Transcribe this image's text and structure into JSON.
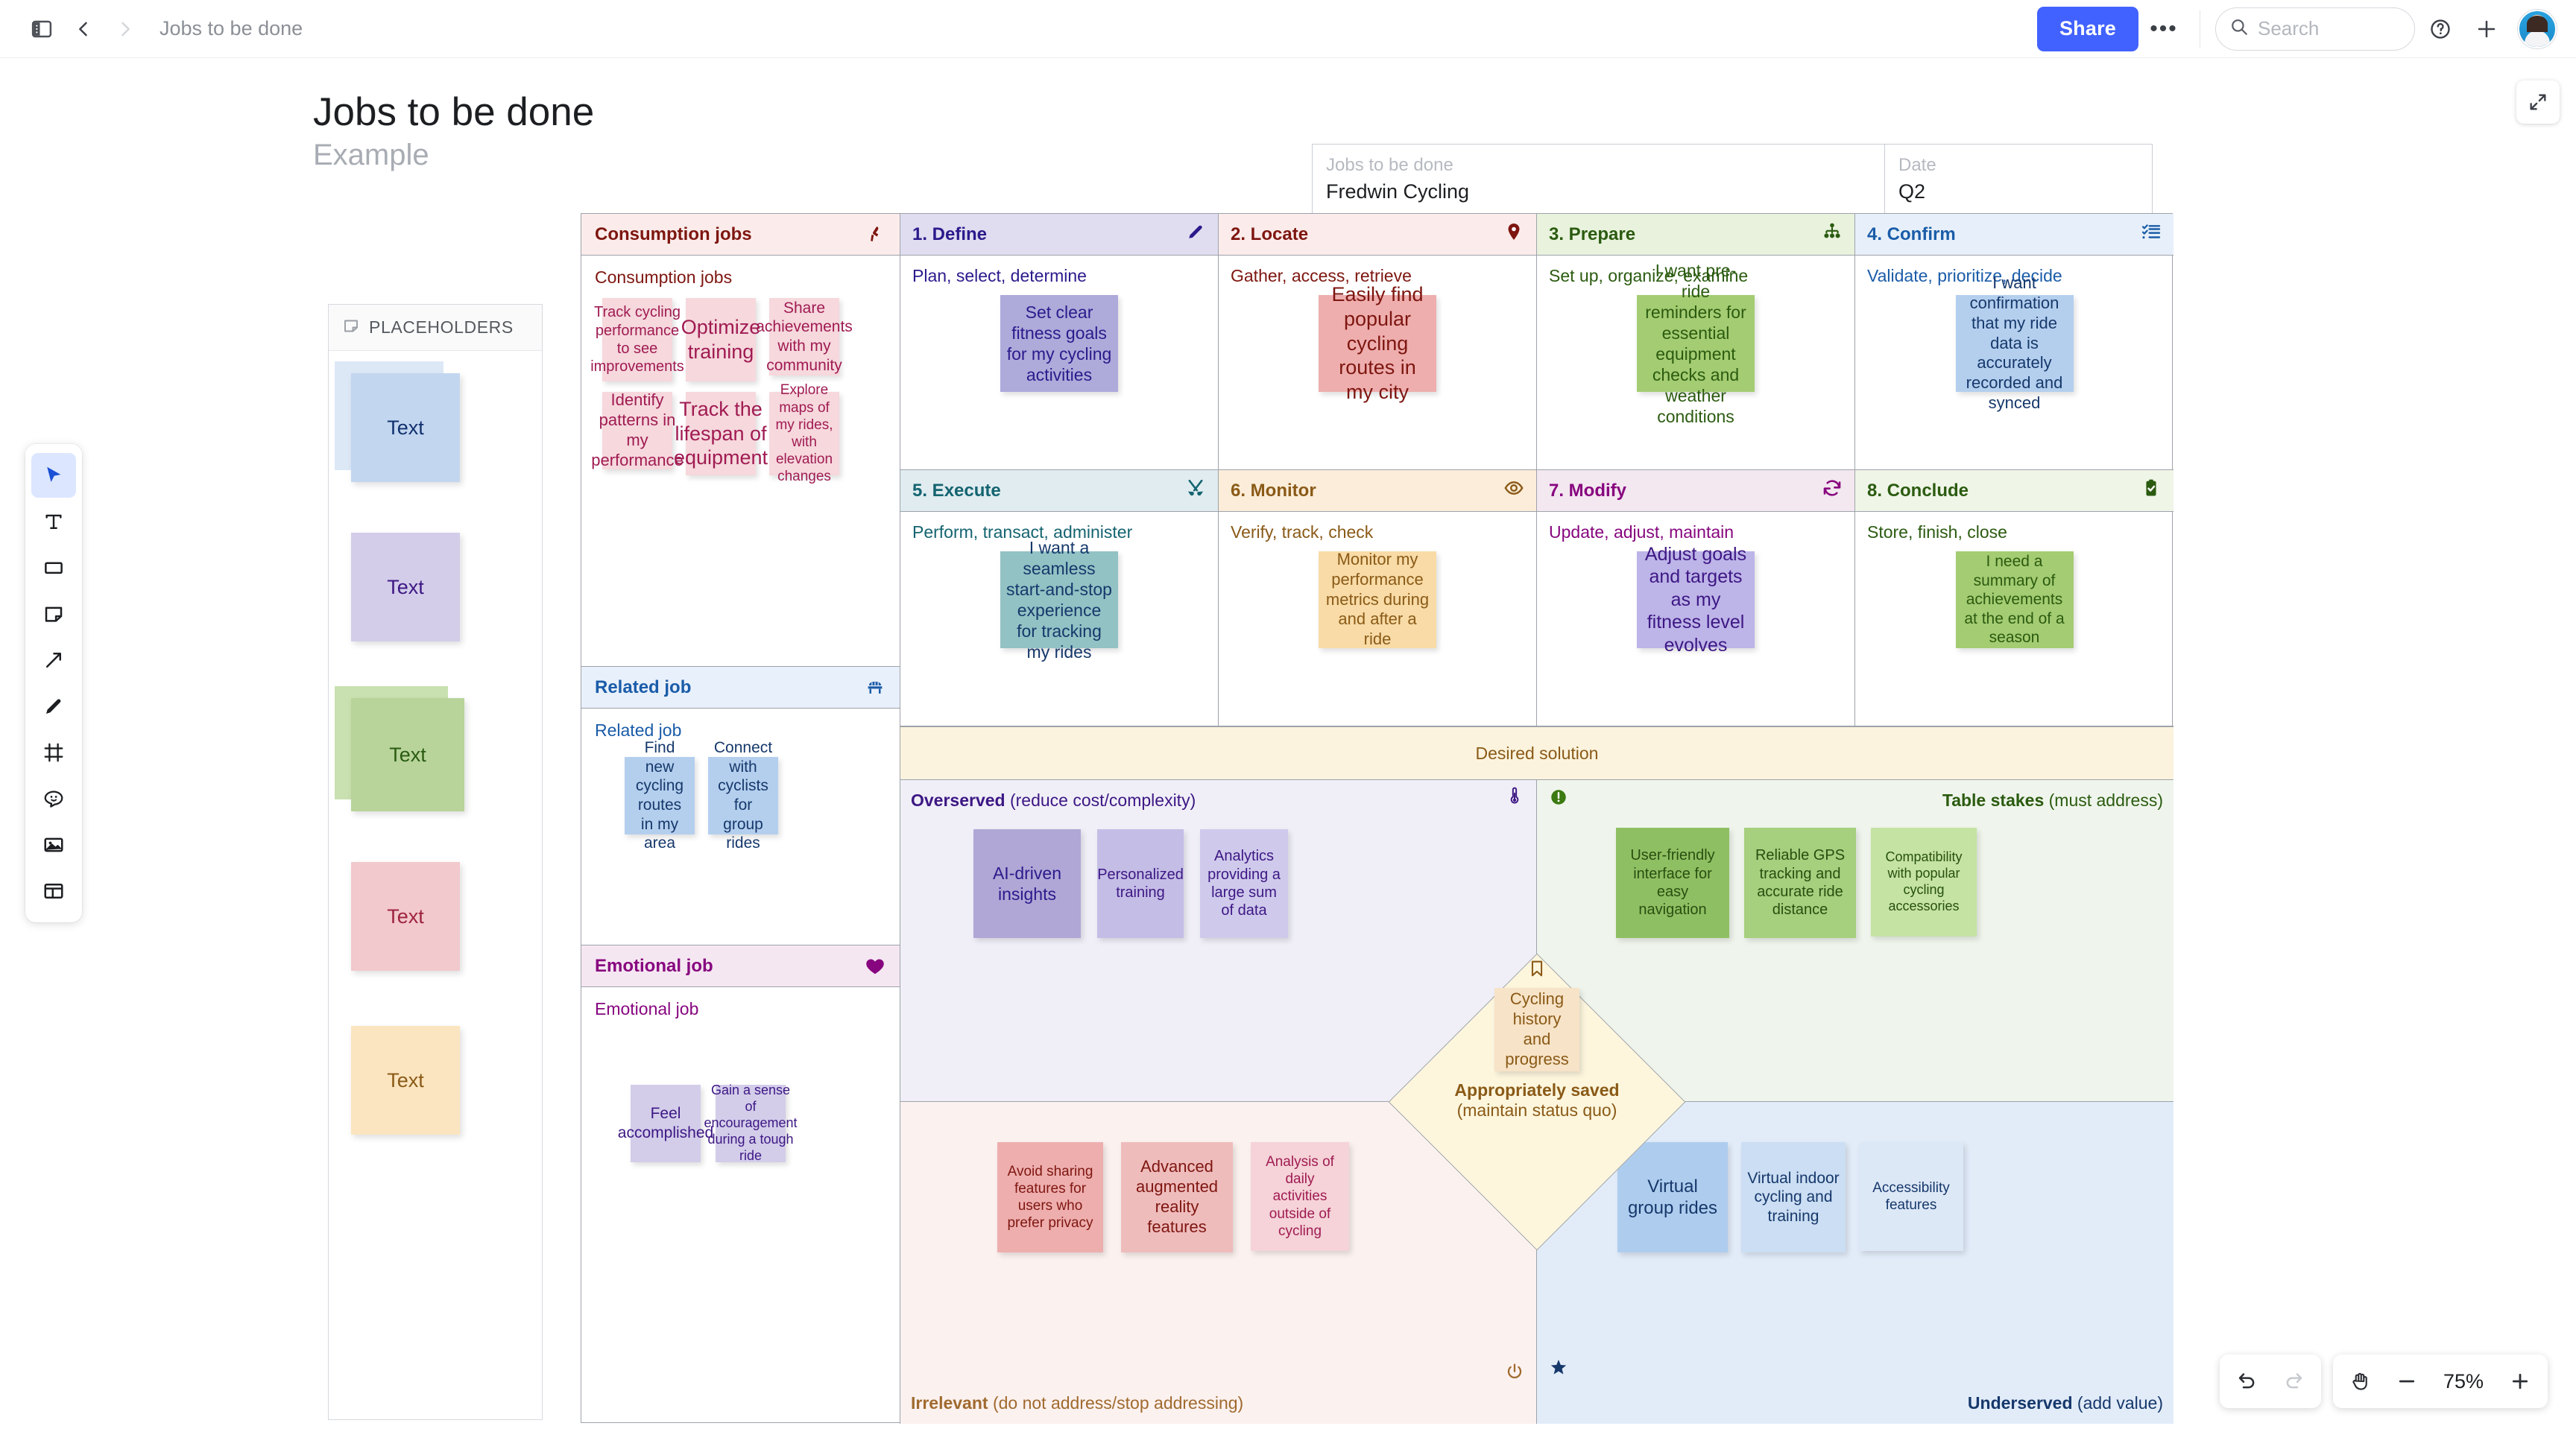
{
  "topbar": {
    "breadcrumb_title": "Jobs to be done",
    "share_label": "Share",
    "more_label": "•••",
    "search_placeholder": "Search",
    "icons": {
      "panel": "sidebar-panel-icon",
      "back": "chevron-left-icon",
      "forward": "chevron-right-icon",
      "search": "search-icon",
      "help": "help-circle-icon",
      "plus": "plus-icon",
      "avatar": "user-avatar"
    }
  },
  "toolbar": {
    "tools": [
      {
        "name": "select-tool",
        "icon": "cursor-arrow-icon",
        "active": true
      },
      {
        "name": "text-tool",
        "icon": "text-icon",
        "active": false
      },
      {
        "name": "shape-tool",
        "icon": "rectangle-icon",
        "active": false
      },
      {
        "name": "sticky-note-tool",
        "icon": "sticky-note-icon",
        "active": false
      },
      {
        "name": "connector-tool",
        "icon": "arrow-diagonal-icon",
        "active": false
      },
      {
        "name": "pen-tool",
        "icon": "pencil-icon",
        "active": false
      },
      {
        "name": "frame-tool",
        "icon": "frame-icon",
        "active": false
      },
      {
        "name": "emoji-tool",
        "icon": "smiley-icon",
        "active": false
      },
      {
        "name": "image-tool",
        "icon": "image-icon",
        "active": false
      },
      {
        "name": "template-tool",
        "icon": "layout-template-icon",
        "active": false
      }
    ]
  },
  "page": {
    "title": "Jobs to be done",
    "subtitle": "Example",
    "expand_icon": "expand-arrows-icon"
  },
  "meta": {
    "field1_label": "Jobs to be done",
    "field1_value": "Fredwin Cycling",
    "field2_label": "Date",
    "field2_value": "Q2"
  },
  "placeholders": {
    "header": "PLACEHOLDERS",
    "header_icon": "sticky-note-icon",
    "notes": [
      {
        "text": "Text",
        "color": "#c3d6f0",
        "back": "#dde8f7",
        "fg": "#11316e",
        "stacked": true
      },
      {
        "text": "Text",
        "color": "#d3cdea",
        "back": "",
        "fg": "#3d1784",
        "stacked": false
      },
      {
        "text": "Text",
        "color": "#b8d49a",
        "back": "#c9e0b0",
        "fg": "#2a5b12",
        "stacked": true
      },
      {
        "text": "Text",
        "color": "#f2c9cd",
        "back": "",
        "fg": "#9e2340",
        "stacked": false
      },
      {
        "text": "Text",
        "color": "#fbe5c0",
        "back": "",
        "fg": "#8a5a17",
        "stacked": false
      }
    ]
  },
  "board": {
    "consumption": {
      "header": "Consumption jobs",
      "header_icon": "running-person-icon",
      "subtitle": "Consumption jobs",
      "header_bg": "#fbeceb",
      "fg": "#7e1610",
      "notes": [
        {
          "text": "Track cycling performance to see improvements",
          "size": 20
        },
        {
          "text": "Optimize training",
          "size": 27
        },
        {
          "text": "Share achievements with my community",
          "size": 21
        },
        {
          "text": "Identify patterns in my performance",
          "size": 22
        },
        {
          "text": "Track the lifespan of equipment",
          "size": 27
        },
        {
          "text": "Explore maps of my rides, with elevation changes",
          "size": 19
        }
      ],
      "note_bg": "#f6d8dd",
      "note_fg": "#a01b52"
    },
    "related": {
      "header": "Related job",
      "header_icon": "bench-icon",
      "subtitle": "Related job",
      "header_bg": "#e8f0fb",
      "fg": "#1a5ca8",
      "note_bg": "#b4cfee",
      "note_fg": "#16386b",
      "notes": [
        {
          "text": "Find new cycling routes in my area",
          "size": 21
        },
        {
          "text": "Connect with cyclists for group rides",
          "size": 21
        }
      ]
    },
    "emotional": {
      "header": "Emotional job",
      "header_icon": "heart-icon",
      "subtitle": "Emotional job",
      "header_bg": "#f5e7f2",
      "fg": "#87067f",
      "note_bg": "#d3cdea",
      "note_fg": "#3d1784",
      "notes": [
        {
          "text": "Feel accomplished",
          "size": 21
        },
        {
          "text": "Gain a sense of encouragement during a tough ride",
          "size": 18
        }
      ]
    },
    "stages": [
      {
        "header": "1. Define",
        "icon": "pen-icon",
        "subtitle": "Plan, select, determine",
        "header_bg": "#e0ddf0",
        "fg": "#2b1a8c",
        "note": "Set clear fitness goals for my cycling activities",
        "note_bg": "#aeaada",
        "note_fg": "#2b1a8c",
        "note_size": 23
      },
      {
        "header": "2. Locate",
        "icon": "map-pin-icon",
        "subtitle": "Gather, access, retrieve",
        "header_bg": "#fbeceb",
        "fg": "#7e1610",
        "note": "Easily find popular cycling routes in my city",
        "note_bg": "#eeaeae",
        "note_fg": "#7e1610",
        "note_size": 27
      },
      {
        "header": "3. Prepare",
        "icon": "hierarchy-icon",
        "subtitle": "Set up, organize, examine",
        "header_bg": "#e8f2dd",
        "fg": "#2b5b10",
        "note": "I want pre-ride reminders for essential equipment checks and weather conditions",
        "note_bg": "#a4cc72",
        "note_fg": "#2b5b10",
        "note_size": 23
      },
      {
        "header": "4. Confirm",
        "icon": "checklist-icon",
        "subtitle": "Validate, prioritize, decide",
        "header_bg": "#e7f0fa",
        "fg": "#1a5ca8",
        "note": "I want confirmation that my ride data is accurately recorded and synced",
        "note_bg": "#b4cfee",
        "note_fg": "#16386b",
        "note_size": 22
      },
      {
        "header": "5. Execute",
        "icon": "tools-icon",
        "subtitle": "Perform, transact, administer",
        "header_bg": "#e0ecf0",
        "fg": "#146470",
        "note": "I want a seamless start-and-stop experience for tracking my rides",
        "note_bg": "#92c2c4",
        "note_fg": "#16386b",
        "note_size": 23
      },
      {
        "header": "6. Monitor",
        "icon": "eye-icon",
        "subtitle": "Verify, track, check",
        "header_bg": "#fbedd9",
        "fg": "#8a5a17",
        "note": "Monitor my performance metrics during and after a ride",
        "note_bg": "#f8dba6",
        "note_fg": "#8a5a17",
        "note_size": 22
      },
      {
        "header": "7. Modify",
        "icon": "refresh-icon",
        "subtitle": "Update, adjust, maintain",
        "header_bg": "#f3e7f0",
        "fg": "#87067f",
        "note": "Adjust goals and targets as my fitness level evolves",
        "note_bg": "#bdb4e8",
        "note_fg": "#3d1784",
        "note_size": 25
      },
      {
        "header": "8. Conclude",
        "icon": "clipboard-check-icon",
        "subtitle": "Store, finish, close",
        "header_bg": "#eff5e7",
        "fg": "#2b5b10",
        "note": "I need a summary of achievements at the end of a season",
        "note_bg": "#a4cc72",
        "note_fg": "#2b5b10",
        "note_size": 21
      }
    ],
    "desired_solution": "Desired solution",
    "matrix": {
      "overserved": {
        "label_bold": "Overserved",
        "label_rest": " (reduce cost/complexity)",
        "bg": "#f0eff8",
        "fg": "#3d1784",
        "icon": "thermometer-icon",
        "notes": [
          {
            "text": "AI-driven insights",
            "bg": "#b0a7d6",
            "fg": "#2b1a8c",
            "size": 23,
            "w": 144,
            "h": 146
          },
          {
            "text": "Personalized training",
            "bg": "#c4bde6",
            "fg": "#3d1784",
            "size": 20,
            "w": 116,
            "h": 146
          },
          {
            "text": "Analytics providing a large sum of data",
            "bg": "#cfcaec",
            "fg": "#3d1784",
            "size": 20,
            "w": 118,
            "h": 146
          }
        ]
      },
      "table_stakes": {
        "label_bold": "Table stakes",
        "label_rest": " (must address)",
        "bg": "#eff5ec",
        "fg": "#2b5b10",
        "icon": "exclamation-circle-icon",
        "notes": [
          {
            "text": "User-friendly interface for easy navigation",
            "bg": "#8fbf63",
            "fg": "#27500f",
            "size": 20,
            "w": 152,
            "h": 148
          },
          {
            "text": "Reliable GPS tracking and accurate ride distance",
            "bg": "#a6cf7e",
            "fg": "#27500f",
            "size": 20,
            "w": 150,
            "h": 148
          },
          {
            "text": "Compatibility with popular cycling accessories",
            "bg": "#c5e3a3",
            "fg": "#27500f",
            "size": 18,
            "w": 142,
            "h": 146
          }
        ]
      },
      "irrelevant": {
        "label_bold": "Irrelevant",
        "label_rest": " (do not address/stop addressing)",
        "bg": "#fbf1ef",
        "fg": "#a06a2e",
        "icon": "power-icon",
        "notes": [
          {
            "text": "Avoid sharing features for users who prefer privacy",
            "bg": "#eeaeae",
            "fg": "#7e1610",
            "size": 19,
            "w": 142,
            "h": 148
          },
          {
            "text": "Advanced augmented reality features",
            "bg": "#efbcbc",
            "fg": "#7e1610",
            "size": 22,
            "w": 150,
            "h": 148
          },
          {
            "text": "Analysis of daily activities outside of cycling",
            "bg": "#f5d3d8",
            "fg": "#a01b52",
            "size": 19,
            "w": 132,
            "h": 146
          }
        ]
      },
      "underserved": {
        "label_bold": "Underserved",
        "label_rest": " (add value)",
        "bg": "#e2ecf9",
        "fg": "#16386b",
        "icon": "star-icon",
        "notes": [
          {
            "text": "Virtual group rides",
            "bg": "#aecdee",
            "fg": "#16386b",
            "size": 24,
            "w": 148,
            "h": 148
          },
          {
            "text": "Virtual indoor cycling and training",
            "bg": "#cbdef3",
            "fg": "#16386b",
            "size": 21,
            "w": 140,
            "h": 148
          },
          {
            "text": "Accessibility features",
            "bg": "#dde8f7",
            "fg": "#16386b",
            "size": 19,
            "w": 140,
            "h": 146
          }
        ]
      },
      "center": {
        "icon": "bookmark-icon",
        "note": "Cycling history and progress",
        "note_bg": "#f7e3c7",
        "note_fg": "#8a5a17",
        "label_bold": "Appropriately saved",
        "label_rest": "(maintain status quo)",
        "fg": "#8a5a17"
      }
    }
  },
  "bottom_controls": {
    "undo_icon": "undo-arrow-icon",
    "redo_icon": "redo-arrow-icon",
    "hand_icon": "hand-icon",
    "zoom_out_icon": "minus-icon",
    "zoom_value": "75%",
    "zoom_in_icon": "plus-icon"
  }
}
